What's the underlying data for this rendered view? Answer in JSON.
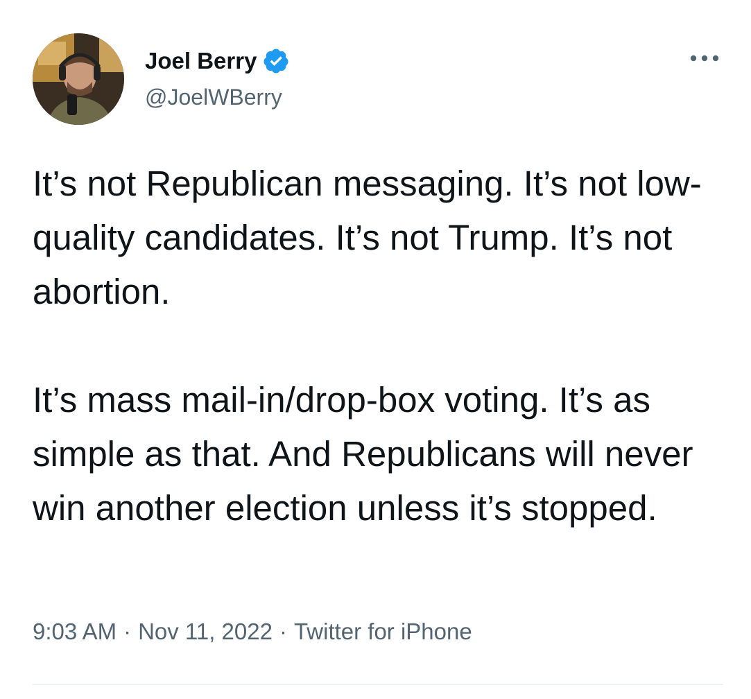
{
  "author": {
    "display_name": "Joel Berry",
    "handle": "@JoelWBerry",
    "verified": true,
    "verified_color": "#1d9bf0"
  },
  "tweet": {
    "paragraphs": [
      "It’s not Republican messaging. It’s not low-quality candidates. It’s not Trump. It’s not abortion.",
      "It’s mass mail-in/drop-box voting. It’s as simple as that. And Republicans will never win another election unless it’s stopped."
    ],
    "time": "9:03 AM",
    "separator": "·",
    "date": "Nov 11, 2022",
    "source": "Twitter for iPhone"
  },
  "icons": {
    "more": "more-horizontal-icon",
    "verified": "verified-badge-icon",
    "avatar": "avatar"
  },
  "colors": {
    "text_primary": "#0f1419",
    "text_secondary": "#536471",
    "accent": "#1d9bf0"
  }
}
